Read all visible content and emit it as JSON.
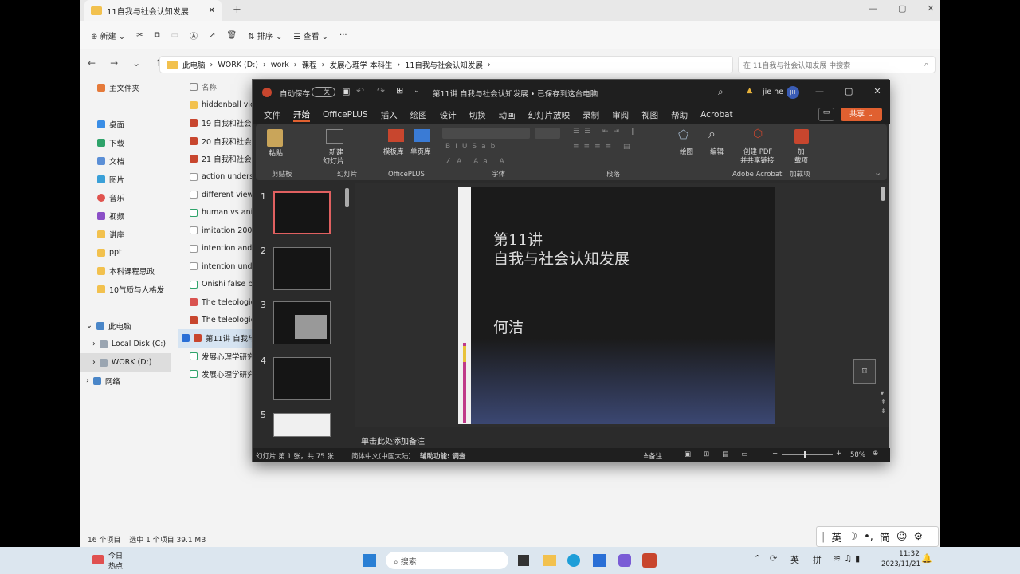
{
  "explorer": {
    "tab_title": "11自我与社会认知发展",
    "new_tab": "+",
    "tab_close": "✕",
    "toolbar": {
      "new": "新建",
      "sort": "排序",
      "view": "查看",
      "more": "···"
    },
    "breadcrumb": [
      "此电脑",
      "WORK (D:)",
      "work",
      "课程",
      "发展心理学 本科生",
      "11自我与社会认知发展"
    ],
    "search_placeholder": "在 11自我与社会认知发展 中搜索",
    "nav": [
      {
        "label": "主文件夹"
      },
      {
        "label": "桌面"
      },
      {
        "label": "下载"
      },
      {
        "label": "文档"
      },
      {
        "label": "图片"
      },
      {
        "label": "音乐"
      },
      {
        "label": "视频"
      },
      {
        "label": "讲座"
      },
      {
        "label": "ppt"
      },
      {
        "label": "本科课程思政"
      },
      {
        "label": "10气质与人格发"
      },
      {
        "label": "此电脑"
      },
      {
        "label": "Local Disk (C:)"
      },
      {
        "label": "WORK (D:)"
      },
      {
        "label": "网络"
      }
    ],
    "column_name": "名称",
    "files": [
      "hiddenball vide",
      "19 自我和社会认",
      "20 自我和社会认",
      "21 自我和社会认",
      "action understa",
      "different views",
      "human vs anim",
      "imitation 2007",
      "intention and s",
      "intention unde",
      "Onishi false bel",
      "The teleologica",
      "The teleologica",
      "第11讲 自我与社",
      "发展心理学研究",
      "发展心理学研究"
    ],
    "status_items": "16 个项目",
    "status_selected": "选中 1 个项目 39.1 MB"
  },
  "ppt": {
    "autosave": "自动保存",
    "autosave_state": "关",
    "title": "第11讲 自我与社会认知发展 • 已保存到这台电脑",
    "user": "jie he",
    "user_initials": "JH",
    "menu": [
      "文件",
      "开始",
      "OfficePLUS",
      "插入",
      "绘图",
      "设计",
      "切换",
      "动画",
      "幻灯片放映",
      "录制",
      "审阅",
      "视图",
      "帮助",
      "Acrobat"
    ],
    "share": "共享",
    "ribbon": {
      "paste": "粘贴",
      "clipboard": "剪贴板",
      "new_slide": "新建",
      "new_slide2": "幻灯片",
      "slides": "幻灯片",
      "template": "模板库",
      "single": "单页库",
      "officeplus": "OfficePLUS",
      "font": "字体",
      "paragraph": "段落",
      "draw": "绘图",
      "edit": "编辑",
      "pdf1": "创建 PDF",
      "pdf2": "并共享链接",
      "acrobat": "Adobe Acrobat",
      "addin1": "加",
      "addin2": "载项",
      "addins": "加载项"
    },
    "slide": {
      "line1": "第11讲",
      "line2": "自我与社会认知发展",
      "author": "何洁"
    },
    "thumb_numbers": [
      "1",
      "2",
      "3",
      "4",
      "5"
    ],
    "notes": "单击此处添加备注",
    "status": {
      "slide": "幻灯片 第 1 张，共 75 张",
      "lang": "简体中文(中国大陆)",
      "access": "辅助功能: 调查",
      "notes": "备注",
      "zoom": "58%"
    }
  },
  "taskbar": {
    "news1": "今日",
    "news2": "热点",
    "search": "搜索",
    "ime1": "英",
    "ime2": "拼",
    "time": "11:32",
    "date": "2023/11/21"
  },
  "imebar": {
    "lang": "英",
    "simp": "简"
  }
}
